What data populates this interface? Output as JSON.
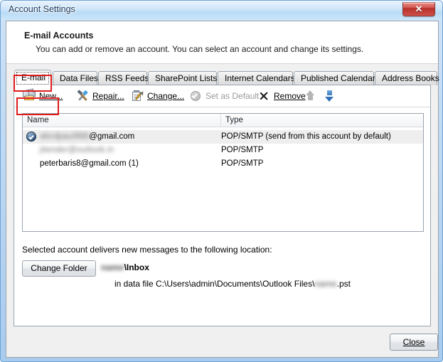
{
  "window": {
    "title": "Account Settings",
    "close_glyph": "✕",
    "close_title": "Close"
  },
  "header": {
    "title": "E-mail Accounts",
    "subtitle": "You can add or remove an account. You can select an account and change its settings."
  },
  "tabs": [
    {
      "label": "E-mail",
      "selected": true
    },
    {
      "label": "Data Files",
      "selected": false
    },
    {
      "label": "RSS Feeds",
      "selected": false
    },
    {
      "label": "SharePoint Lists",
      "selected": false
    },
    {
      "label": "Internet Calendars",
      "selected": false
    },
    {
      "label": "Published Calendars",
      "selected": false
    },
    {
      "label": "Address Books",
      "selected": false
    }
  ],
  "toolbar": {
    "new_label": "New...",
    "repair_label": "Repair...",
    "change_label": "Change...",
    "set_default_label": "Set as Default",
    "remove_label": "Remove",
    "move_up_label": "Move Up",
    "move_down_label": "Move Down"
  },
  "list": {
    "columns": [
      "Name",
      "Type"
    ],
    "rows": [
      {
        "name_redacted": "abcdpaul988",
        "name_suffix": "@gmail.com",
        "type": "POP/SMTP (send from this account by default)",
        "selected": true,
        "is_default": true
      },
      {
        "name_redacted": "jitender@outlook.in",
        "name_suffix": "",
        "type": "POP/SMTP",
        "selected": false,
        "is_default": false
      },
      {
        "name_redacted": "",
        "name_suffix": "peterbaris8@gmail.com (1)",
        "type": "POP/SMTP",
        "selected": false,
        "is_default": false
      }
    ]
  },
  "delivery": {
    "label": "Selected account delivers new messages to the following location:",
    "change_folder_label": "Change Folder",
    "folder_redacted": "name",
    "folder_path": "\\Inbox",
    "data_file_prefix": "in data file C:\\Users\\admin\\Documents\\Outlook Files\\",
    "data_file_redacted": "name",
    "data_file_suffix": ".pst"
  },
  "footer": {
    "close_label": "Close"
  },
  "colors": {
    "annotation": "#e01b1b",
    "title_text": "#1b3a5c",
    "dialog_bg": "#f0f0f0",
    "selection": "#eeeeee"
  }
}
